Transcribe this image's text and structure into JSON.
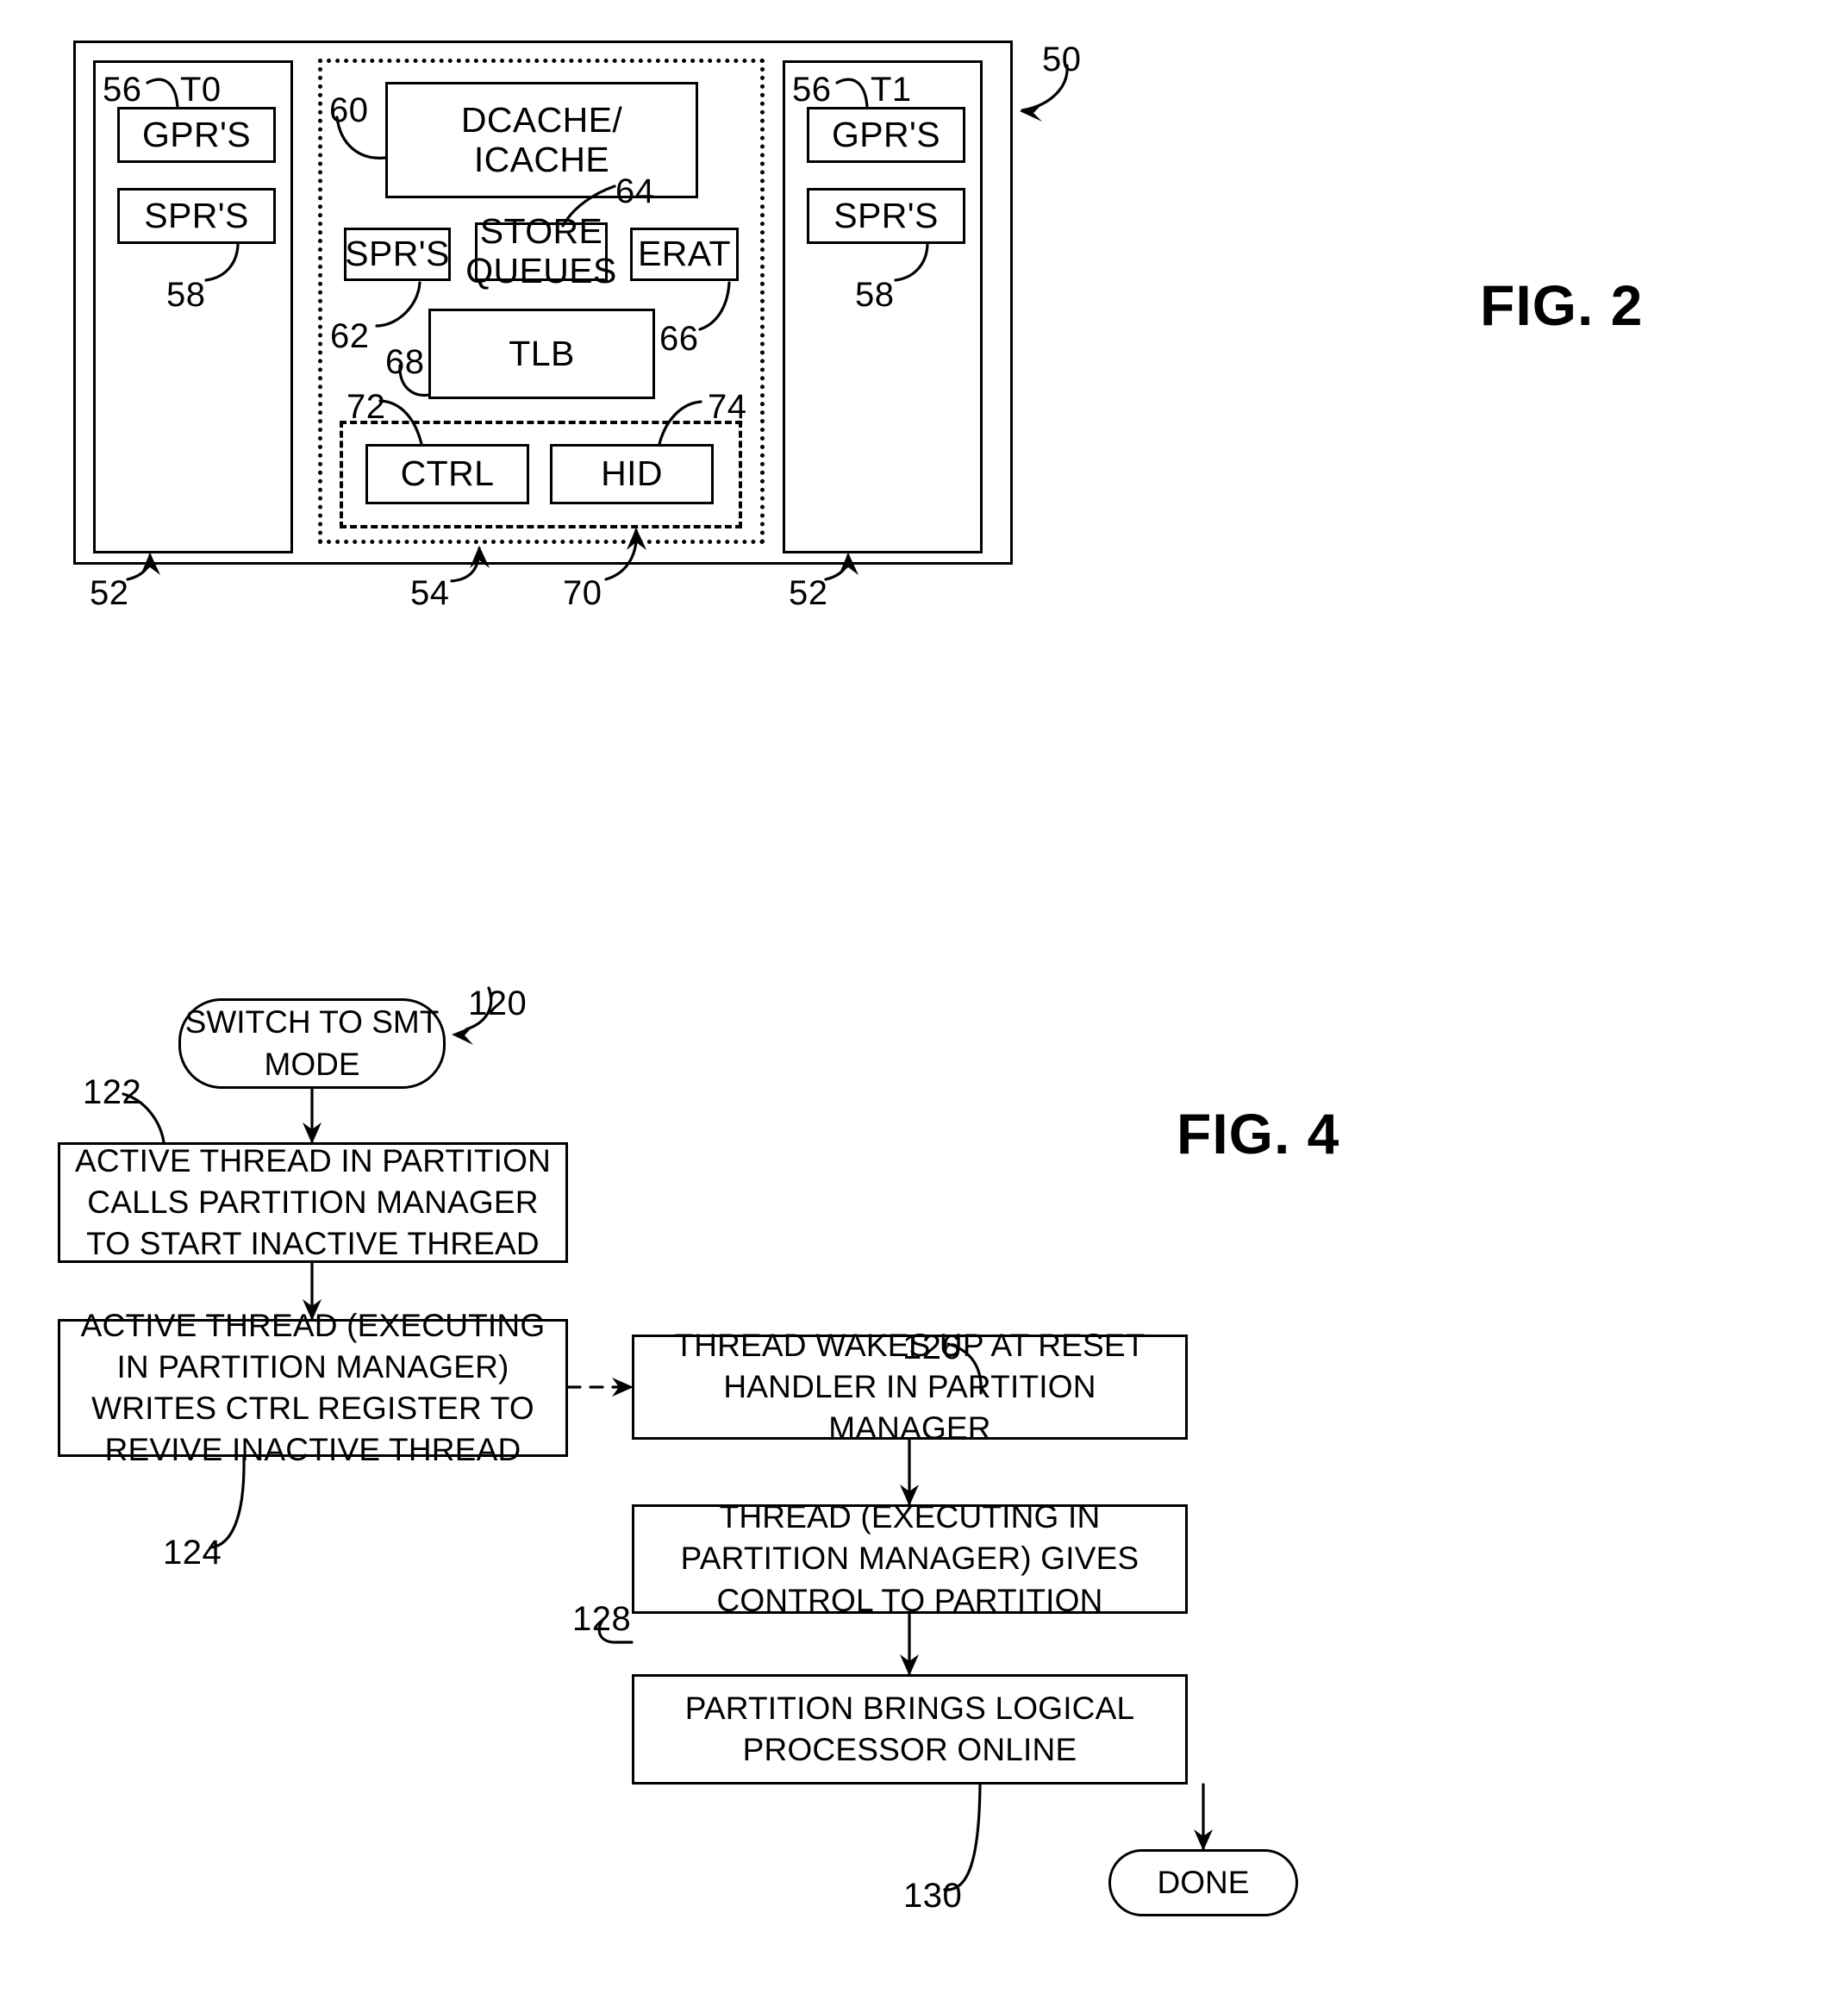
{
  "figures": [
    {
      "id": "fig2",
      "caption": "FIG. 2",
      "outer_ref": "50",
      "threads": [
        {
          "name": "T0",
          "thread_ref": "56",
          "block_ref": "52",
          "registers": [
            {
              "label": "GPR'S"
            },
            {
              "label": "SPR'S",
              "ref": "58"
            }
          ]
        },
        {
          "name": "T1",
          "thread_ref": "56",
          "block_ref": "52",
          "registers": [
            {
              "label": "GPR'S"
            },
            {
              "label": "SPR'S",
              "ref": "58"
            }
          ]
        }
      ],
      "shared": {
        "block_ref": "54",
        "cache": {
          "label": "DCACHE/\nICACHE",
          "line1": "DCACHE/",
          "line2": "ICACHE",
          "ref": "60"
        },
        "spr": {
          "label": "SPR'S",
          "ref": "62"
        },
        "store_queues": {
          "line1": "STORE",
          "line2": "QUEUES",
          "ref": "64"
        },
        "erat": {
          "label": "ERAT",
          "ref": "66"
        },
        "tlb": {
          "label": "TLB",
          "ref": "68"
        },
        "register_group": {
          "ref": "70",
          "registers": [
            {
              "label": "CTRL",
              "ref": "72"
            },
            {
              "label": "HID",
              "ref": "74"
            }
          ]
        }
      }
    },
    {
      "id": "fig4",
      "caption": "FIG. 4",
      "nodes": [
        {
          "key": "start",
          "type": "terminal",
          "ref": "120",
          "text": "SWITCH TO SMT MODE"
        },
        {
          "key": "step122",
          "type": "process",
          "ref": "122",
          "text": "ACTIVE THREAD IN PARTITION CALLS PARTITION MANAGER TO START INACTIVE THREAD"
        },
        {
          "key": "step124",
          "type": "process",
          "ref": "124",
          "text": "ACTIVE THREAD (EXECUTING IN PARTITION MANAGER) WRITES CTRL REGISTER TO REVIVE INACTIVE THREAD"
        },
        {
          "key": "step126",
          "type": "process",
          "ref": "126",
          "text": "THREAD WAKES UP AT RESET HANDLER IN PARTITION MANAGER"
        },
        {
          "key": "step128",
          "type": "process",
          "ref": "128",
          "text": "THREAD (EXECUTING IN PARTITION MANAGER) GIVES CONTROL TO PARTITION"
        },
        {
          "key": "step130",
          "type": "process",
          "ref": "130",
          "text": "PARTITION BRINGS LOGICAL PROCESSOR ONLINE"
        },
        {
          "key": "done",
          "type": "terminal",
          "text": "DONE"
        }
      ]
    }
  ]
}
